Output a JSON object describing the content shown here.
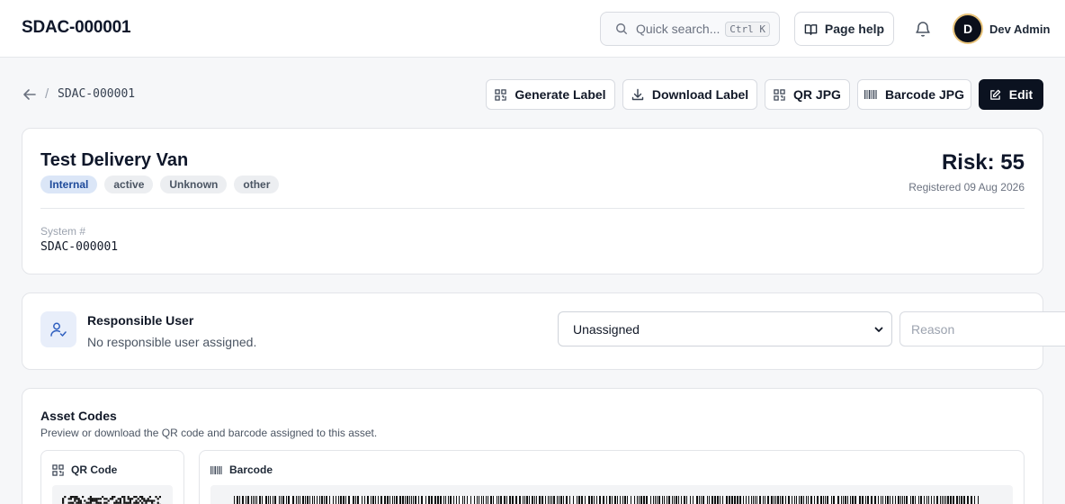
{
  "header": {
    "app_title": "SDAC-000001",
    "search_placeholder": "Quick search...",
    "search_shortcut": "Ctrl K",
    "page_help_label": "Page help",
    "avatar_initial": "D",
    "user_name": "Dev Admin"
  },
  "breadcrumb": {
    "separator": "/",
    "current": "SDAC-000001"
  },
  "actions": {
    "generate_label": "Generate Label",
    "download_label": "Download Label",
    "qr_jpg": "QR JPG",
    "barcode_jpg": "Barcode JPG",
    "edit": "Edit"
  },
  "asset": {
    "name": "Test Delivery Van",
    "badges": [
      "Internal",
      "active",
      "Unknown",
      "other"
    ],
    "risk": "Risk: 55",
    "registered": "Registered 09 Aug 2026",
    "system_label": "System #",
    "system_value": "SDAC-000001"
  },
  "responsible_user": {
    "title": "Responsible User",
    "subtitle": "No responsible user assigned.",
    "select_value": "Unassigned",
    "reason_placeholder": "Reason"
  },
  "asset_codes": {
    "title": "Asset Codes",
    "subtitle": "Preview or download the QR code and barcode assigned to this asset.",
    "qr_heading": "QR Code",
    "barcode_heading": "Barcode"
  },
  "colors": {
    "primary_button": "#0b1220",
    "badge_accent_bg": "#dbe6f7",
    "badge_accent_text": "#1e4a9a",
    "avatar_ring": "#e8c37a"
  },
  "icons": [
    "search-icon",
    "book-icon",
    "bell-icon",
    "back-arrow-icon",
    "qr-icon",
    "download-icon",
    "barcode-icon",
    "edit-icon",
    "user-check-icon",
    "chevron-down-icon"
  ]
}
